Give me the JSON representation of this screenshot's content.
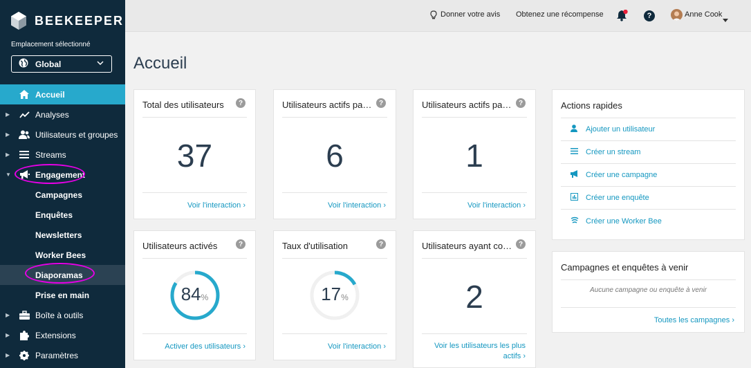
{
  "sidebar": {
    "brand": "BEEKEEPER",
    "location_label": "Emplacement sélectionné",
    "location_value": "Global",
    "items": [
      {
        "label": "Accueil"
      },
      {
        "label": "Analyses"
      },
      {
        "label": "Utilisateurs et groupes"
      },
      {
        "label": "Streams"
      },
      {
        "label": "Engagement"
      },
      {
        "label": "Campagnes"
      },
      {
        "label": "Enquêtes"
      },
      {
        "label": "Newsletters"
      },
      {
        "label": "Worker Bees"
      },
      {
        "label": "Diaporamas"
      },
      {
        "label": "Prise en main"
      },
      {
        "label": "Boîte à outils"
      },
      {
        "label": "Extensions"
      },
      {
        "label": "Paramètres"
      }
    ]
  },
  "topbar": {
    "feedback": "Donner votre avis",
    "reward": "Obtenez une récompense",
    "user": "Anne Cook"
  },
  "page": {
    "title": "Accueil"
  },
  "cards": {
    "total": {
      "title": "Total des utilisateurs",
      "value": "37",
      "link": "Voir l'interaction ›"
    },
    "active1": {
      "title": "Utilisateurs actifs pa…",
      "value": "6",
      "link": "Voir l'interaction ›"
    },
    "active2": {
      "title": "Utilisateurs actifs pa…",
      "value": "1",
      "link": "Voir l'interaction ›"
    },
    "activated": {
      "title": "Utilisateurs activés",
      "value": "84",
      "unit": "%",
      "percent": 84,
      "link": "Activer des utilisateurs ›"
    },
    "usage": {
      "title": "Taux d'utilisation",
      "value": "17",
      "unit": "%",
      "percent": 17,
      "link": "Voir l'interaction ›"
    },
    "having": {
      "title": "Utilisateurs ayant co…",
      "value": "2",
      "link_line1": "Voir les utilisateurs les plus",
      "link_line2": "actifs ›"
    }
  },
  "quick_actions": {
    "title": "Actions rapides",
    "items": [
      {
        "label": "Ajouter un utilisateur",
        "icon": "user-icon"
      },
      {
        "label": "Créer un stream",
        "icon": "list-icon"
      },
      {
        "label": "Créer une campagne",
        "icon": "megaphone-icon"
      },
      {
        "label": "Créer une enquête",
        "icon": "survey-icon"
      },
      {
        "label": "Créer une Worker Bee",
        "icon": "worker-bee-icon"
      }
    ]
  },
  "upcoming": {
    "title": "Campagnes et enquêtes à venir",
    "empty": "Aucune campagne ou enquête à venir",
    "link": "Toutes les campagnes ›"
  },
  "colors": {
    "accent": "#27a9cc",
    "sidebar": "#0f2a3c",
    "link": "#1497c0",
    "annotation": "#e600e6"
  }
}
